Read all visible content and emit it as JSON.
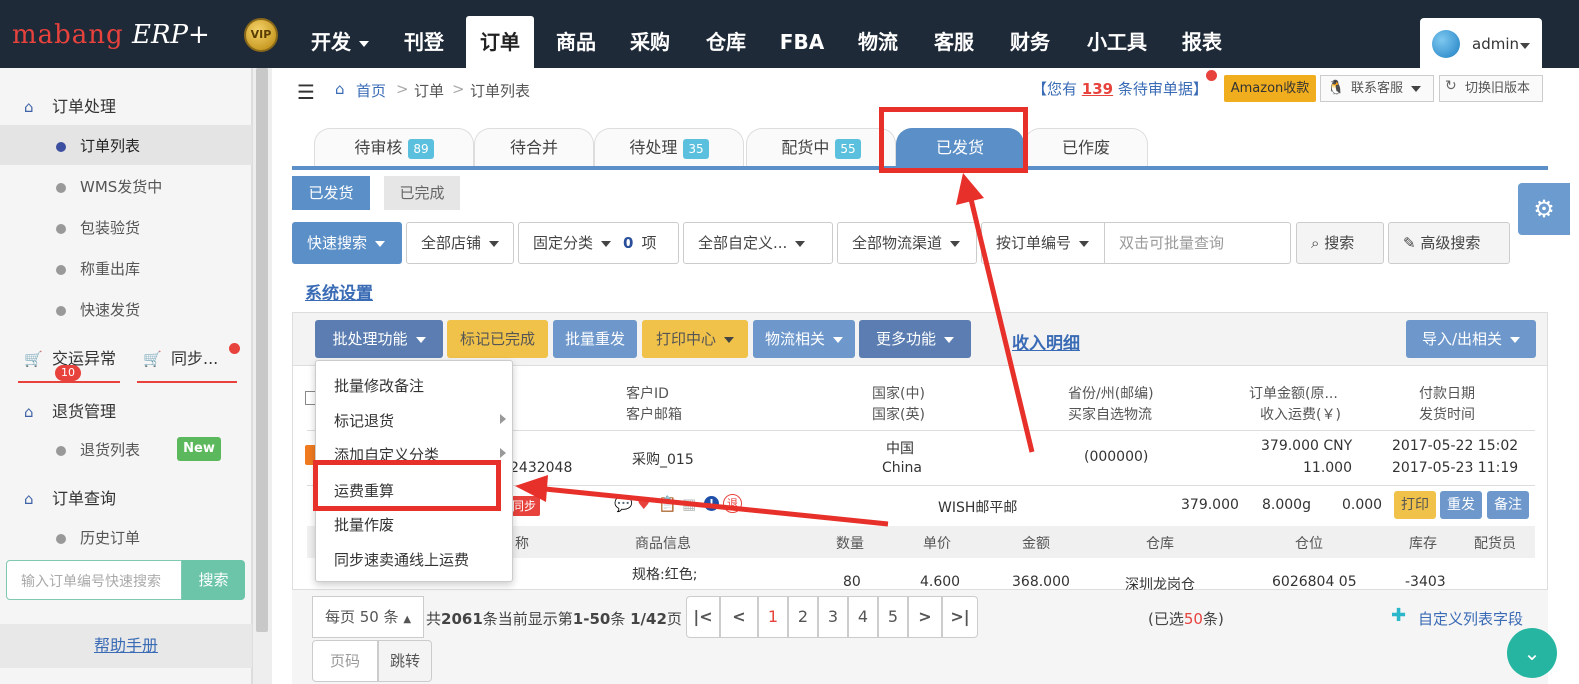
{
  "logo": {
    "brand": "mabang",
    "product": "ERP+",
    "vip": "VIP"
  },
  "nav": {
    "items": [
      "开发",
      "刊登",
      "订单",
      "商品",
      "采购",
      "仓库",
      "FBA",
      "物流",
      "客服",
      "财务",
      "小工具",
      "报表"
    ],
    "active": "订单",
    "user": "admin"
  },
  "breadcrumb": {
    "home": "首页",
    "level1": "订单",
    "level2": "订单列表"
  },
  "notice": {
    "prefix": "【您有",
    "count": "139",
    "suffix": "条待审单据】"
  },
  "top_buttons": {
    "amazon": "Amazon收款",
    "service": "联系客服",
    "old_version": "切换旧版本"
  },
  "sidebar": {
    "sections": [
      {
        "title": "订单处理",
        "items": [
          "订单列表",
          "WMS发货中",
          "包装验货",
          "称重出库",
          "快速发货"
        ]
      },
      {
        "title": "交运异常",
        "badge": "10",
        "sibling": "同步..."
      },
      {
        "title": "退货管理",
        "items": [
          "退货列表"
        ],
        "new_badge": "New"
      },
      {
        "title": "订单查询",
        "items": [
          "历史订单"
        ]
      }
    ],
    "active_item": "订单列表",
    "search_placeholder": "输入订单编号快速搜索",
    "search_button": "搜索",
    "help": "帮助手册"
  },
  "tabs": [
    {
      "label": "待审核",
      "badge": "89"
    },
    {
      "label": "待合并",
      "badge": ""
    },
    {
      "label": "待处理",
      "badge": "35"
    },
    {
      "label": "配货中",
      "badge": "55"
    },
    {
      "label": "已发货",
      "badge": "",
      "active": true
    },
    {
      "label": "已作废",
      "badge": ""
    }
  ],
  "subtabs": {
    "shipped": "已发货",
    "completed": "已完成"
  },
  "filters": {
    "quick_search": "快速搜索",
    "shops": "全部店铺",
    "fixed_category": "固定分类",
    "category_count": "0",
    "category_unit": "项",
    "custom": "全部自定义...",
    "logistics": "全部物流渠道",
    "by_order": "按订单编号",
    "batch_placeholder": "双击可批量查询",
    "search": "搜索",
    "advanced": "高级搜索"
  },
  "system_settings": "系统设置",
  "actions": {
    "batch": "批处理功能",
    "mark_done": "标记已完成",
    "resend": "批量重发",
    "print_center": "打印中心",
    "logistics": "物流相关",
    "more": "更多功能",
    "income": "收入明细",
    "import_export": "导入/出相关"
  },
  "dropdown": [
    "批量修改备注",
    "标记退货",
    "添加自定义分类",
    "运费重算",
    "批量作废",
    "同步速卖通线上运费"
  ],
  "table_header": {
    "customer_id": "客户ID",
    "customer_email": "客户邮箱",
    "country_cn": "国家(中)",
    "country_en": "国家(英)",
    "province": "省份/州(邮编)",
    "buyer_logistics": "买家自选物流",
    "order_amount": "订单金额(原...",
    "income_freight": "收入运费(￥)",
    "pay_date": "付款日期",
    "ship_time": "发货时间"
  },
  "order": {
    "order_no_partial": "2432048",
    "customer": "采购_015",
    "country_cn": "中国",
    "country_en": "China",
    "zip": "(000000)",
    "amount": "379.000 CNY",
    "freight": "11.000",
    "pay_date": "2017-05-22 15:02",
    "ship_time": "2017-05-23 11:19",
    "sync_tag": "同步",
    "return_tag": "退",
    "logistics": "WISH邮平邮",
    "sub_amount": "379.000",
    "weight": "8.000g",
    "fee": "0.000",
    "btn_print": "打印",
    "btn_resend": "重发",
    "btn_note": "备注"
  },
  "detail_header": {
    "name": "称",
    "product_info": "商品信息",
    "qty": "数量",
    "price": "单价",
    "amount": "金额",
    "warehouse": "仓库",
    "location": "仓位",
    "stock": "库存",
    "picker": "配货员"
  },
  "detail_row": {
    "spec": "规格:红色;",
    "qty": "80",
    "price": "4.600",
    "amount": "368.000",
    "warehouse": "深圳龙岗仓",
    "location": "6026804 05",
    "stock": "-3403"
  },
  "pagination": {
    "per_page": "每页 50 条",
    "total_text": "共",
    "total": "2061",
    "showing": "条当前显示第",
    "range": "1-50",
    "page_sep": "条 ",
    "page": "1/42",
    "page_suffix": "页",
    "pages": [
      "1",
      "2",
      "3",
      "4",
      "5"
    ],
    "current": "1",
    "selected_prefix": "(已选",
    "selected": "50",
    "selected_suffix": "条)",
    "custom_fields": "自定义列表字段",
    "page_input": "页码",
    "jump": "跳转"
  },
  "colors": {
    "nav_bg": "#1f2a38",
    "accent": "#5b8fc7",
    "highlight": "#e8302a",
    "green": "#6cc5a9"
  }
}
